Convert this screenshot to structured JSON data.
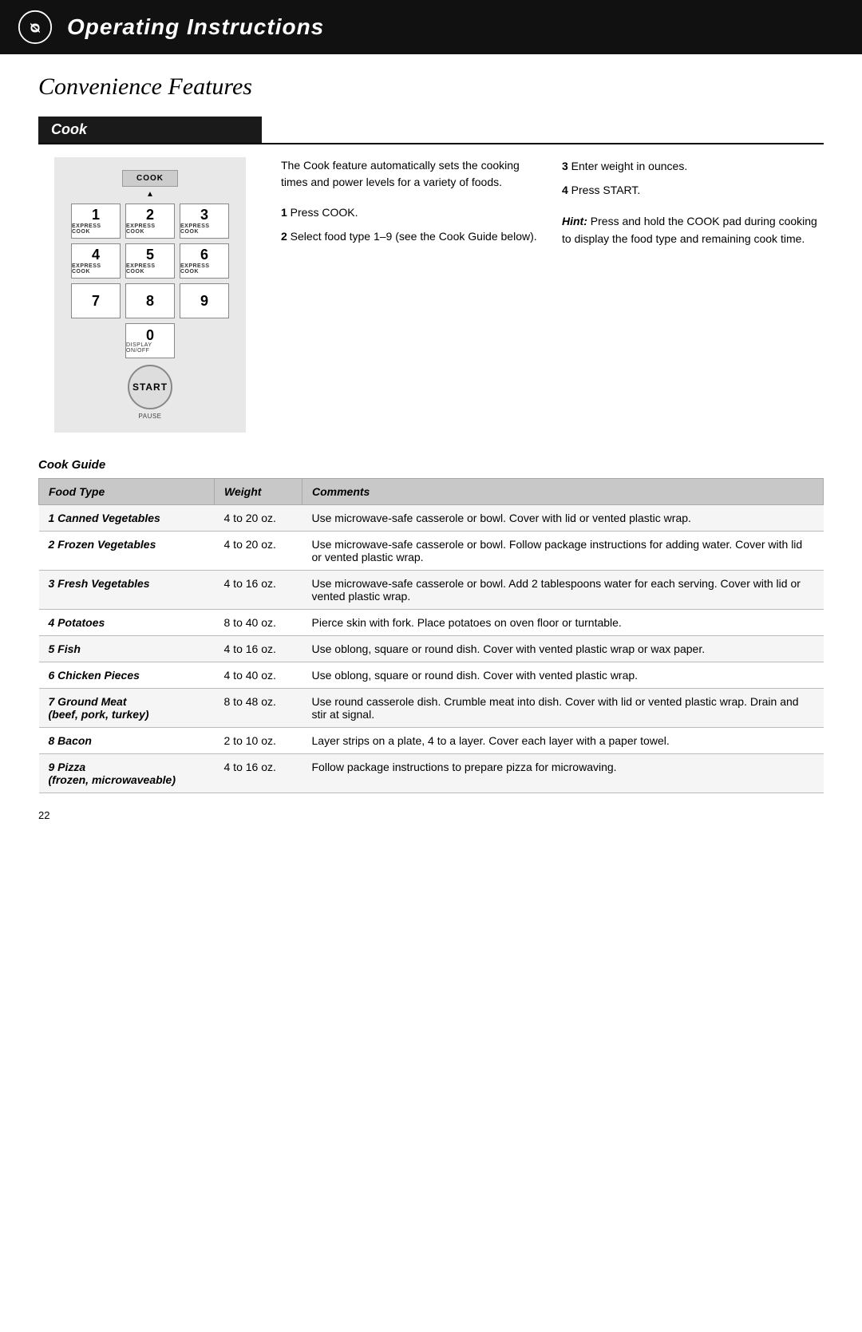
{
  "header": {
    "title": "Operating Instructions",
    "page_number": "22"
  },
  "section_title": "Convenience Features",
  "cook_section": {
    "header": "Cook",
    "description": "The Cook feature automatically sets the cooking times and power levels for a variety of foods.",
    "steps": [
      {
        "num": "1",
        "text": "Press COOK."
      },
      {
        "num": "2",
        "text": "Select food type 1–9 (see the Cook Guide below)."
      },
      {
        "num": "3",
        "text": "Enter weight in ounces."
      },
      {
        "num": "4",
        "text": "Press START."
      }
    ],
    "hint_label": "Hint:",
    "hint_text": "Press and hold the COOK pad during cooking to display the food type and remaining cook time."
  },
  "keypad": {
    "cook_label": "COOK",
    "keys": [
      {
        "number": "1",
        "label": "EXPRESS COOK"
      },
      {
        "number": "2",
        "label": "EXPRESS COOK"
      },
      {
        "number": "3",
        "label": "EXPRESS COOK"
      },
      {
        "number": "4",
        "label": "EXPRESS COOK"
      },
      {
        "number": "5",
        "label": "EXPRESS COOK"
      },
      {
        "number": "6",
        "label": "EXPRESS COOK"
      },
      {
        "number": "7",
        "label": ""
      },
      {
        "number": "8",
        "label": ""
      },
      {
        "number": "9",
        "label": ""
      },
      {
        "number": "0",
        "label": "DISPLAY ON/OFF"
      }
    ],
    "start_label": "START",
    "pause_label": "PAUSE"
  },
  "cook_guide": {
    "title": "Cook Guide",
    "columns": {
      "food_type": "Food Type",
      "weight": "Weight",
      "comments": "Comments"
    },
    "rows": [
      {
        "food_type": "1 Canned Vegetables",
        "food_sub": "",
        "weight": "4 to 20 oz.",
        "comments": "Use microwave-safe casserole or bowl. Cover with lid or vented plastic wrap."
      },
      {
        "food_type": "2 Frozen Vegetables",
        "food_sub": "",
        "weight": "4 to 20 oz.",
        "comments": "Use microwave-safe casserole or bowl. Follow package instructions for adding water. Cover with lid or vented plastic wrap."
      },
      {
        "food_type": "3 Fresh Vegetables",
        "food_sub": "",
        "weight": "4 to 16 oz.",
        "comments": "Use microwave-safe casserole or bowl. Add 2 tablespoons water for each serving. Cover with lid or vented plastic wrap."
      },
      {
        "food_type": "4 Potatoes",
        "food_sub": "",
        "weight": "8 to 40 oz.",
        "comments": "Pierce skin with fork. Place potatoes on oven floor or turntable."
      },
      {
        "food_type": "5 Fish",
        "food_sub": "",
        "weight": "4 to 16 oz.",
        "comments": "Use oblong, square or round dish. Cover with vented plastic wrap or wax paper."
      },
      {
        "food_type": "6 Chicken Pieces",
        "food_sub": "",
        "weight": "4 to 40 oz.",
        "comments": "Use oblong, square or round dish. Cover with vented plastic wrap."
      },
      {
        "food_type": "7 Ground Meat",
        "food_sub": "(beef, pork, turkey)",
        "weight": "8 to 48 oz.",
        "comments": "Use round casserole dish. Crumble meat into dish. Cover with lid or vented plastic wrap. Drain and stir at signal."
      },
      {
        "food_type": "8 Bacon",
        "food_sub": "",
        "weight": "2 to 10 oz.",
        "comments": "Layer strips on a plate, 4 to a layer. Cover each layer with a paper towel."
      },
      {
        "food_type": "9 Pizza",
        "food_sub": "(frozen, microwaveable)",
        "weight": "4 to 16 oz.",
        "comments": "Follow package instructions to prepare pizza for microwaving."
      }
    ]
  }
}
